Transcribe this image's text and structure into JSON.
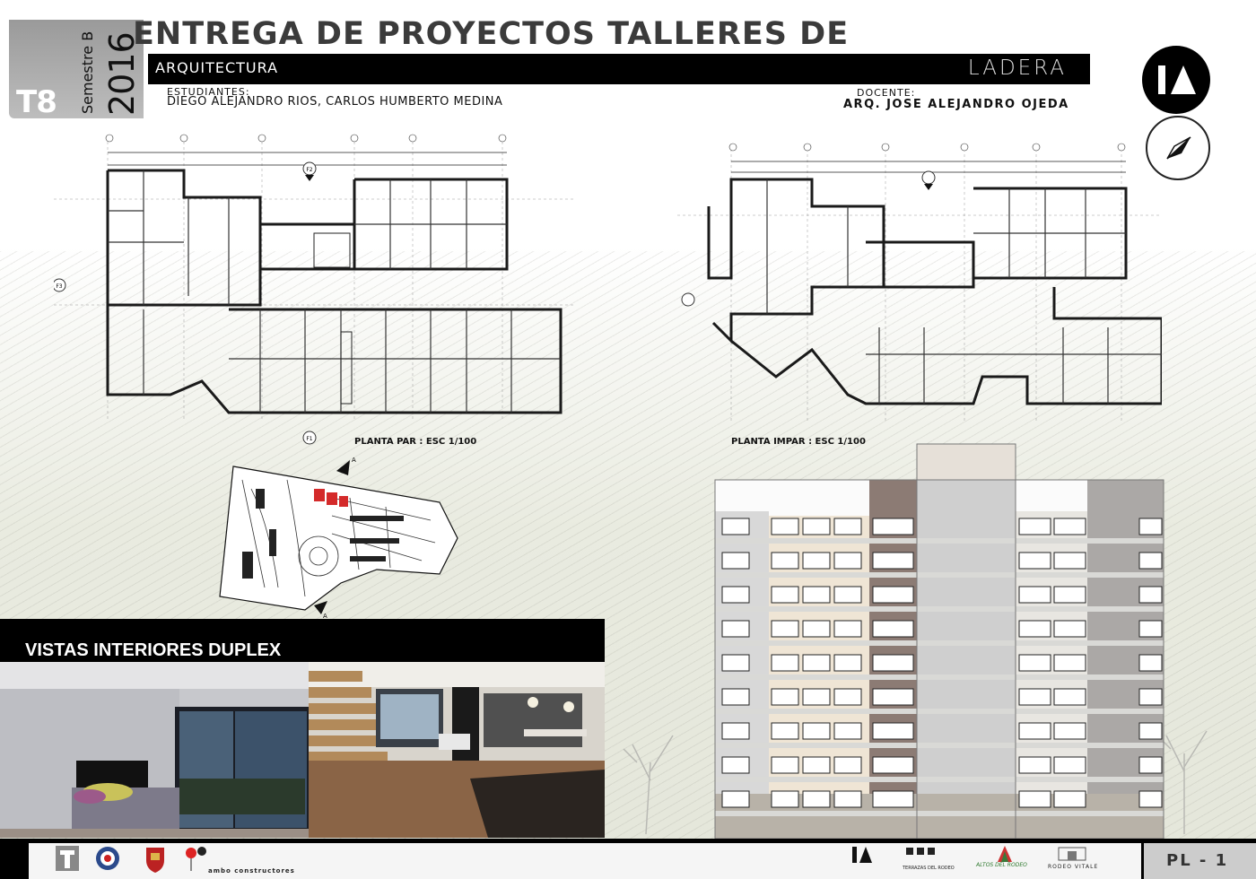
{
  "header": {
    "code": "T8",
    "semester": "Semestre B",
    "year": "2016",
    "title": "ENTREGA DE PROYECTOS TALLERES DE",
    "subtitle": "ARQUITECTURA",
    "project": "LADERA",
    "students_label": "ESTUDIANTES:",
    "students": "DIEGO ALEJANDRO RIOS, CARLOS HUMBERTO MEDINA",
    "teacher_label": "DOCENTE:",
    "teacher": "ARQ. JOSE ALEJANDRO OJEDA"
  },
  "plans": {
    "left_caption": "PLANTA PAR : ESC 1/100",
    "right_caption": "PLANTA IMPAR : ESC 1/100",
    "markers": [
      "F1",
      "F2",
      "F3"
    ]
  },
  "site_plan": {
    "markers": [
      "A",
      "A"
    ]
  },
  "renders": {
    "title": "VISTAS INTERIORES DUPLEX"
  },
  "footer": {
    "logos": [
      "ambo constructores",
      "TERRAZAS DEL RODEO",
      "ALTOS DEL RODEO",
      "RODEO VITALE"
    ],
    "page": "PL - 1"
  },
  "colors": {
    "accent_red": "#d42a2a",
    "panel_black": "#000000",
    "brick": "#8c7b74"
  }
}
